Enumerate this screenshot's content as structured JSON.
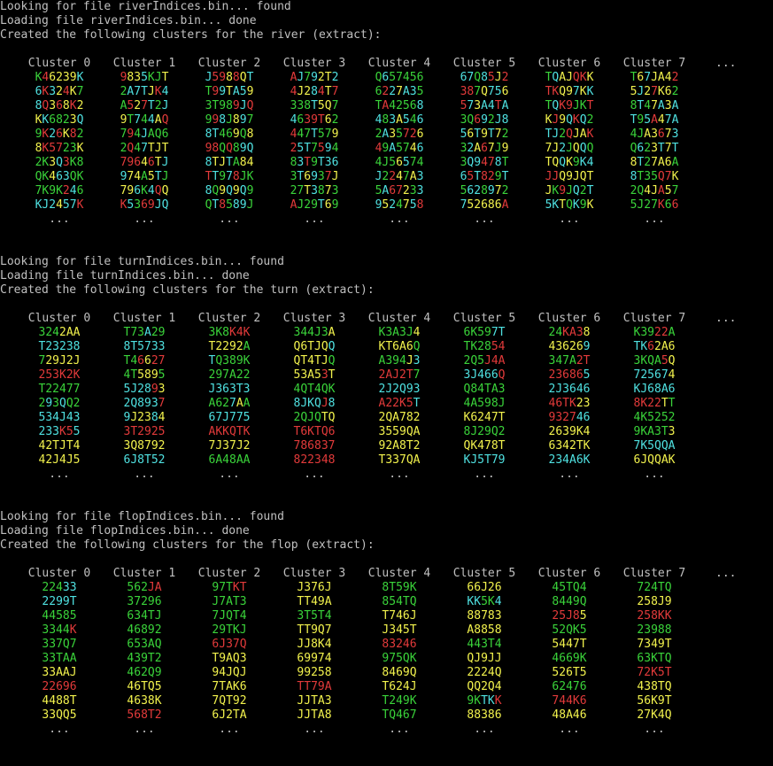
{
  "colors": {
    "h": "#3ad33a",
    "s": "#f2f24d",
    "d": "#4fe1e1",
    "c": "#e23a3a",
    "default": "#c0c0c0"
  },
  "more": "...",
  "dots": "...",
  "sections": [
    {
      "lines": [
        "Looking for file riverIndices.bin... found",
        "Loading file riverIndices.bin... done",
        "Created the following clusters for the river (extract):"
      ],
      "headers": [
        "Cluster 0",
        "Cluster 1",
        "Cluster 2",
        "Cluster 3",
        "Cluster 4",
        "Cluster 5",
        "Cluster 6",
        "Cluster 7"
      ],
      "rows": [
        [
          "K46239K",
          "9835KJT",
          "J5988QT",
          "AJ792T2",
          "Q657456",
          "67Q85J2",
          "TQAJQKK",
          "T67JA42"
        ],
        [
          "6K324K7",
          "2A7TJK4",
          "T99TA59",
          "4J284T7",
          "6227A35",
          "387Q756",
          "TKQ97KK",
          "5J27K62"
        ],
        [
          "8Q368K2",
          "A527T2J",
          "3T989JQ",
          "338T5Q7",
          "TA42568",
          "573A4TA",
          "TQK9JKT",
          "8T47A3A"
        ],
        [
          "KK6823Q",
          "9T744AQ",
          "998J897",
          "4639T62",
          "483A546",
          "3Q692J8",
          "KJ9QKQ2",
          "T95A47A"
        ],
        [
          "9K26K82",
          "794JAQ6",
          "8T469Q8",
          "447T579",
          "2A35726",
          "56T9T72",
          "TJ2QJAK",
          "4JA3673"
        ],
        [
          "8K5723K",
          "2Q47TJT",
          "98QQ89Q",
          "25T7594",
          "49A5746",
          "32A67J9",
          "7J2JQQQ",
          "Q623T7T"
        ],
        [
          "2K3Q3K8",
          "79646TJ",
          "8TJTA84",
          "83T9T36",
          "4J56574",
          "3Q9478T",
          "TQQK9K4",
          "8T27A6A"
        ],
        [
          "QK463QK",
          "974A5TJ",
          "TT978JK",
          "3T6937J",
          "J2247A3",
          "65T829T",
          "JJQ9JQT",
          "8T35Q7K"
        ],
        [
          "7K9K246",
          "796K4QQ",
          "8Q9Q9Q9",
          "27T3873",
          "5A67233",
          "5628972",
          "JK9JQ2T",
          "2Q4JA57"
        ],
        [
          "KJ2457K",
          "K5369JQ",
          "QT8589J",
          "AJ29T69",
          "9524758",
          "752686A",
          "5KTQK9K",
          "5J27K66"
        ]
      ],
      "colorKeys": [
        [
          "hcssssd",
          "cssdhhs",
          "dccscsd",
          "cdhdssd",
          "hdhhhhh",
          "ddhdcsc",
          "hdssccs",
          "hsdsssc"
        ],
        [
          "dcdscsh",
          "hdddscd",
          "hcdsdds",
          "cssdcsc",
          "hcdsddh",
          "cchsdds",
          "ccssdsd",
          "sdscssh"
        ],
        [
          "dcscscs",
          "hcscdhd",
          "hhhhcdc",
          "hhhdssh",
          "hchhhhd",
          "cdsddcd",
          "hdcchhc",
          "hdhsdsd"
        ],
        [
          "sdhhhsd",
          "shdhdsc",
          "hcdhsdh",
          "dhcccsh",
          "dhdsdhd",
          "hhcdhdd",
          "scsdcdh",
          "dhdcsdd"
        ],
        [
          "hcdcsch",
          "hchdhhh",
          "ddhhshs",
          "chhdhhs",
          "hdshccs",
          "dsdsdsh",
          "ddhcssc",
          "hhsscsd"
        ],
        [
          "sccchhs",
          "hchdsss",
          "cchchdd",
          "cddhcdh",
          "chdhhsd",
          "hdscshs",
          "ssdhsdh",
          "hdhsdsd"
        ],
        [
          "hhsdchh",
          "cccscsd",
          "dssdhss",
          "hdchddd",
          "hhhsdhh",
          "hddccdh",
          "ssdshdd",
          "sdhsssh"
        ],
        [
          "hhsddhh",
          "dsshsdh",
          "cdhdchh",
          "hdsdhcs",
          "dhcshsd",
          "dcdcchd",
          "ccsssss",
          "dhhhccs"
        ],
        [
          "hhhhcdh",
          "ssdhdcs",
          "dhsdsdh",
          "hhsdhsh",
          "hdccshd",
          "hddhdsh",
          "shchdhd",
          "hhsscsh"
        ],
        [
          "dddsddc",
          "cdhccdd",
          "hdchddh",
          "chhhdsh",
          "dsdhsdc",
          "dsssssc",
          "ddshdhs",
          "hhhhchc"
        ]
      ]
    },
    {
      "lines": [
        "Looking for file turnIndices.bin... found",
        "Loading file turnIndices.bin... done",
        "Created the following clusters for the turn (extract):"
      ],
      "headers": [
        "Cluster 0",
        "Cluster 1",
        "Cluster 2",
        "Cluster 3",
        "Cluster 4",
        "Cluster 5",
        "Cluster 6",
        "Cluster 7"
      ],
      "rows": [
        [
          "3242AA",
          "T73A29",
          "3K8K4K",
          "344J3A",
          "K3A3J4",
          "6K597T",
          "24KA38",
          "K3922A"
        ],
        [
          "T23238",
          "8T5733",
          "T2292A",
          "Q6TJQQ",
          "KT6A6Q",
          "TK2854",
          "436269",
          "TK62A6"
        ],
        [
          "729J2J",
          "T46627",
          "TQ389K",
          "QT4TJQ",
          "A394J3",
          "2Q5J4A",
          "347A2T",
          "3KQA5Q"
        ],
        [
          "253K2K",
          "4T5895",
          "297A22",
          "53A53T",
          "2AJ2T7",
          "3J466Q",
          "236865",
          "725674"
        ],
        [
          "T22477",
          "5J2893",
          "J363T3",
          "4QT4QK",
          "2J2Q93",
          "Q84TA3",
          "2J3646",
          "KJ68A6"
        ],
        [
          "293QQ2",
          "2Q8937",
          "A627AA",
          "8JKQJ8",
          "A22K5T",
          "4A598J",
          "46TK23",
          "8K22TT"
        ],
        [
          "534J43",
          "9J2384",
          "67J775",
          "2QJQTQ",
          "2QA782",
          "K6247T",
          "932746",
          "4K5252"
        ],
        [
          "233K55",
          "3T2925",
          "AKKQTK",
          "T6KTQ6",
          "3559QA",
          "8J29Q2",
          "2639K4",
          "9KA3T3"
        ],
        [
          "42TJT4",
          "3Q8792",
          "7J37J2",
          "786837",
          "92A8T2",
          "QK478T",
          "6342TK",
          "7K5QQA"
        ],
        [
          "42J4J5",
          "6J8T52",
          "6A48AA",
          "822348",
          "T337QA",
          "KJ5T79",
          "234A6K",
          "6JQQAK"
        ]
      ],
      "colorKeys": [
        [
          "hhhsss",
          "hhhdhh",
          "hhhccc",
          "hhhhhs",
          "hhhhhs",
          "hhhhdd",
          "hhcccs",
          "hhhcch"
        ],
        [
          "dddddd",
          "dddddd",
          "sssssh",
          "sssssd",
          "sssssh",
          "hhhhcc",
          "sssssd",
          "ddcsss"
        ],
        [
          "hsssss",
          "hhcscc",
          "dhhhhh",
          "sssssh",
          "hhhhsd",
          "hhhccc",
          "hhhhcc",
          "hhhhcs"
        ],
        [
          "cccccc",
          "hhsssh",
          "hhhhhh",
          "sssscs",
          "ccccch",
          "dddddc",
          "cccccd",
          "ddddds"
        ],
        [
          "hhhhhh",
          "ddddcs",
          "dddddd",
          "hhhhhh",
          "dddddd",
          "hhhhhh",
          "dddddd",
          "dddddd"
        ],
        [
          "hdhdhh",
          "dddddc",
          "hhhdsh",
          "ddddcd",
          "cccccd",
          "hhhhhh",
          "ccccss",
          "ccccsh"
        ],
        [
          "dddddd",
          "dsssds",
          "dddddd",
          "hhhhss",
          "ssssss",
          "ssssss",
          "ccccdd",
          "hhhhhh"
        ],
        [
          "dddccd",
          "cccccc",
          "cccccc",
          "cccccc",
          "ssssss",
          "hhhhhh",
          "ssssss",
          "hhhhhs"
        ],
        [
          "ssssss",
          "ssssss",
          "ssssss",
          "cccccc",
          "ssssss",
          "ssssss",
          "ssssss",
          "dddddd"
        ],
        [
          "ssssss",
          "dddddd",
          "hhhhhh",
          "cccccc",
          "ssssss",
          "dddddd",
          "dddddd",
          "ssssss"
        ]
      ]
    },
    {
      "lines": [
        "Looking for file flopIndices.bin... found",
        "Loading file flopIndices.bin... done",
        "Created the following clusters for the flop (extract):"
      ],
      "headers": [
        "Cluster 0",
        "Cluster 1",
        "Cluster 2",
        "Cluster 3",
        "Cluster 4",
        "Cluster 5",
        "Cluster 6",
        "Cluster 7"
      ],
      "rows": [
        [
          "22433",
          "562JA",
          "97TKT",
          "J376J",
          "8T59K",
          "66J26",
          "45TQ4",
          "724TQ"
        ],
        [
          "2299T",
          "37296",
          "J7AT3",
          "TT49A",
          "854TQ",
          "KK5K4",
          "8449Q",
          "258J9"
        ],
        [
          "44585",
          "634TJ",
          "7JQT4",
          "3T5T4",
          "T746J",
          "88783",
          "25J85",
          "258KK"
        ],
        [
          "3344K",
          "46892",
          "29TKJ",
          "TT9Q7",
          "J345T",
          "A8858",
          "52QK5",
          "23988"
        ],
        [
          "337Q7",
          "653AQ",
          "6J37Q",
          "JJ8K4",
          "83246",
          "443T4",
          "5447T",
          "7349T"
        ],
        [
          "33TAA",
          "439T2",
          "T9AQ3",
          "69974",
          "975QK",
          "QJ9JJ",
          "4669K",
          "63KTQ"
        ],
        [
          "33AAJ",
          "462Q9",
          "94JQJ",
          "99258",
          "8469Q",
          "2224Q",
          "526T5",
          "72K5T"
        ],
        [
          "22696",
          "46TQ5",
          "7TAK6",
          "TT79A",
          "T624J",
          "QQ2Q4",
          "62476",
          "438TQ"
        ],
        [
          "4488T",
          "4638K",
          "7QT92",
          "JJTA3",
          "T249K",
          "9KTKK",
          "744K6",
          "56K9T"
        ],
        [
          "33QQ5",
          "568T2",
          "6J2TA",
          "JJTA8",
          "TQ467",
          "88386",
          "48A46",
          "27K4Q"
        ]
      ],
      "colorKeys": [
        [
          "hhhdd",
          "hhhcc",
          "hhhcc",
          "sssss",
          "hhhhh",
          "sssss",
          "hhhhh",
          "hhhhh"
        ],
        [
          "ddddd",
          "hhhhh",
          "hhhhh",
          "sssss",
          "hhhhh",
          "ddhhd",
          "hhhhh",
          "sssss"
        ],
        [
          "hhhhh",
          "hhhhh",
          "hhhhh",
          "hhhhh",
          "sssss",
          "sssss",
          "ccccs",
          "ccccc"
        ],
        [
          "hhhhc",
          "hhhhh",
          "hhhhh",
          "sssss",
          "sssss",
          "sssss",
          "hhhhh",
          "hhhhh"
        ],
        [
          "hhhhh",
          "hhhhh",
          "ccccc",
          "sssss",
          "ccccc",
          "hhhhh",
          "sssss",
          "sssss"
        ],
        [
          "hhhhh",
          "hhhhh",
          "sssss",
          "sssss",
          "hhhhh",
          "sssss",
          "hhhhh",
          "hhhhh"
        ],
        [
          "sssss",
          "hhhhh",
          "sssss",
          "sssss",
          "sssss",
          "sssss",
          "sssss",
          "ccccc"
        ],
        [
          "ccccc",
          "sssss",
          "sssss",
          "ccccc",
          "sssss",
          "sssss",
          "hhhhh",
          "sssss"
        ],
        [
          "sssss",
          "sssss",
          "sssss",
          "sssss",
          "hhhhh",
          "hhddc",
          "ccccc",
          "sssss"
        ],
        [
          "sssss",
          "ccccc",
          "sssss",
          "sssss",
          "hhhhh",
          "sssss",
          "sssss",
          "sssss"
        ]
      ]
    }
  ]
}
